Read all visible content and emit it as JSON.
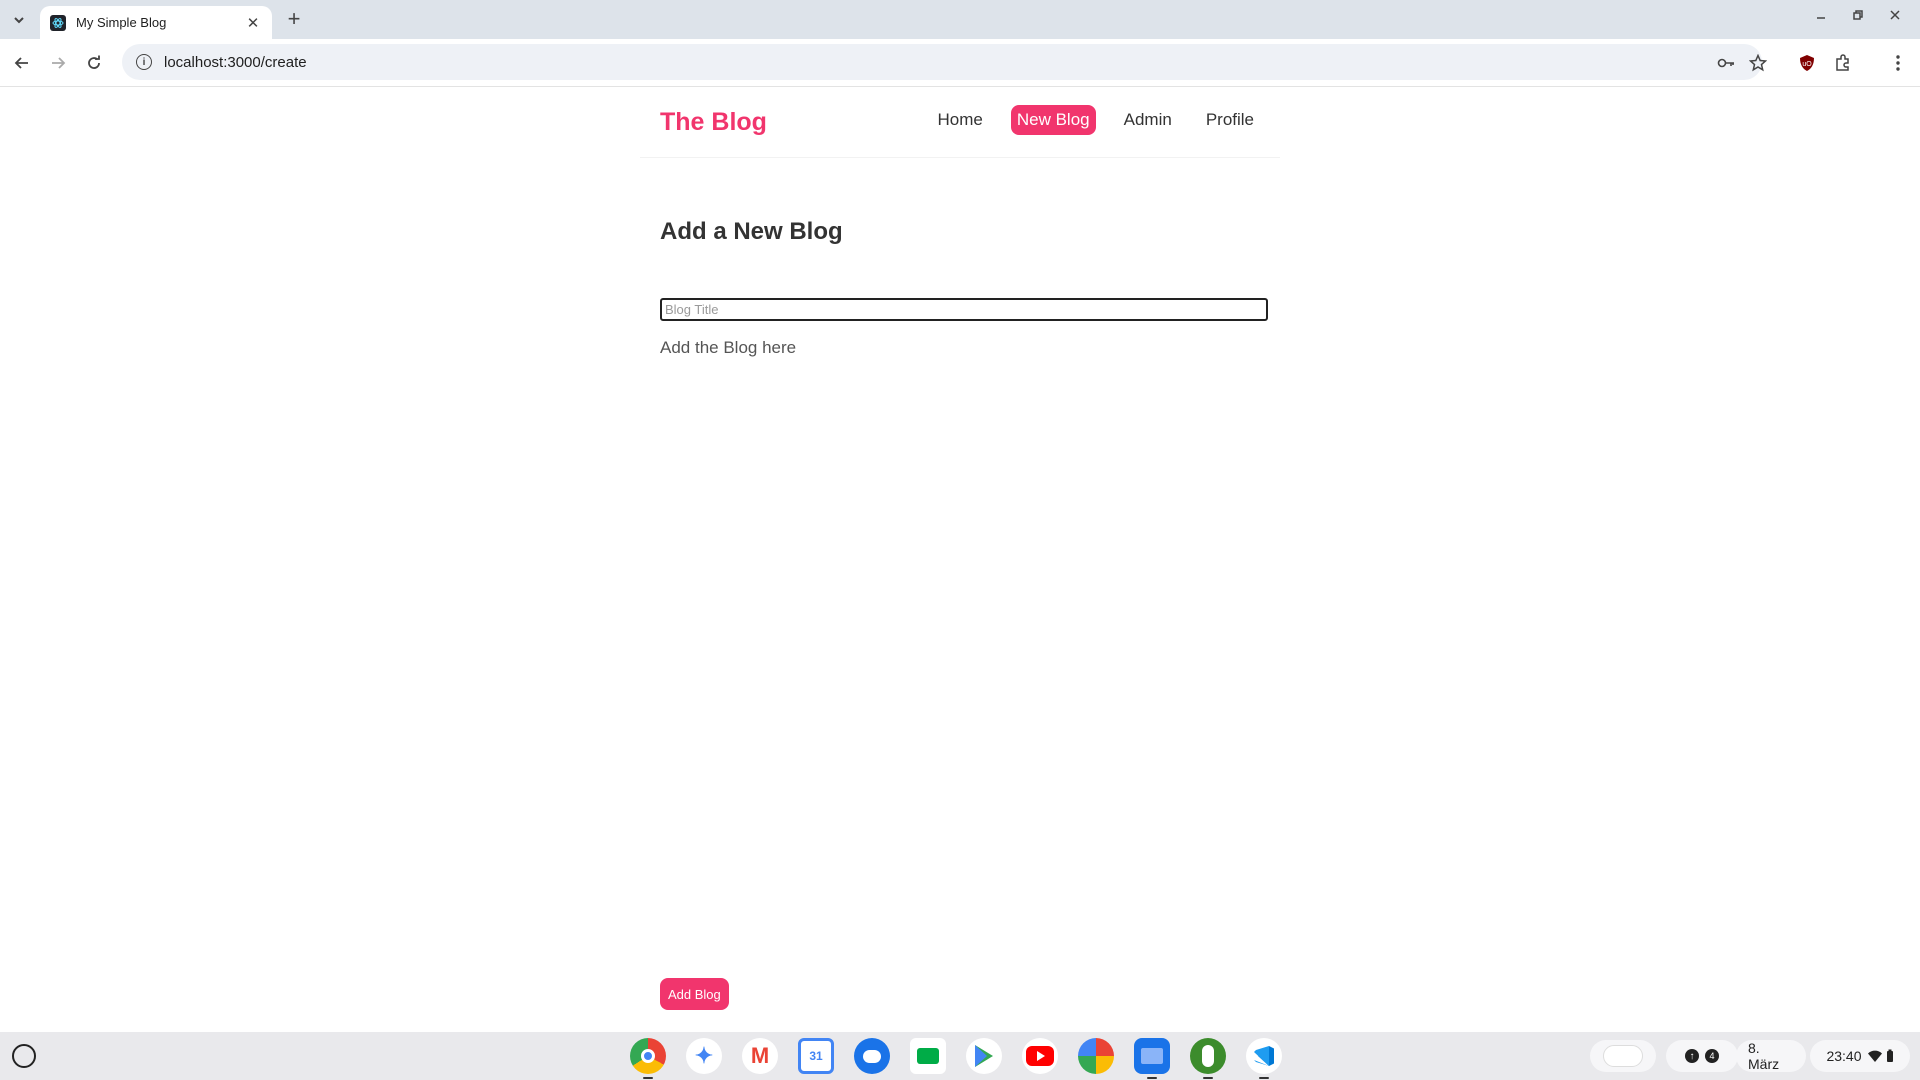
{
  "browser": {
    "tab_title": "My Simple Blog",
    "new_tab_label": "+",
    "tab_close_label": "✕",
    "url": "localhost:3000/create"
  },
  "site": {
    "brand": "The Blog",
    "nav": [
      {
        "label": "Home",
        "active": false
      },
      {
        "label": "New Blog",
        "active": true
      },
      {
        "label": "Admin",
        "active": false
      },
      {
        "label": "Profile",
        "active": false
      }
    ],
    "accent_color": "#f1356d"
  },
  "form": {
    "heading": "Add a New Blog",
    "title_placeholder": "Blog Title",
    "title_value": "",
    "body_placeholder": "Add the Blog here",
    "body_value": "",
    "submit_label": "Add Blog"
  },
  "shelf": {
    "apps": [
      "chrome-icon",
      "gemini-icon",
      "gmail-icon",
      "calendar-icon",
      "messages-icon",
      "meet-icon",
      "play-store-icon",
      "youtube-icon",
      "photos-icon",
      "files-icon",
      "app-icon",
      "vscode-icon"
    ],
    "notification_count": "4",
    "date": "8. März",
    "time": "23:40"
  }
}
